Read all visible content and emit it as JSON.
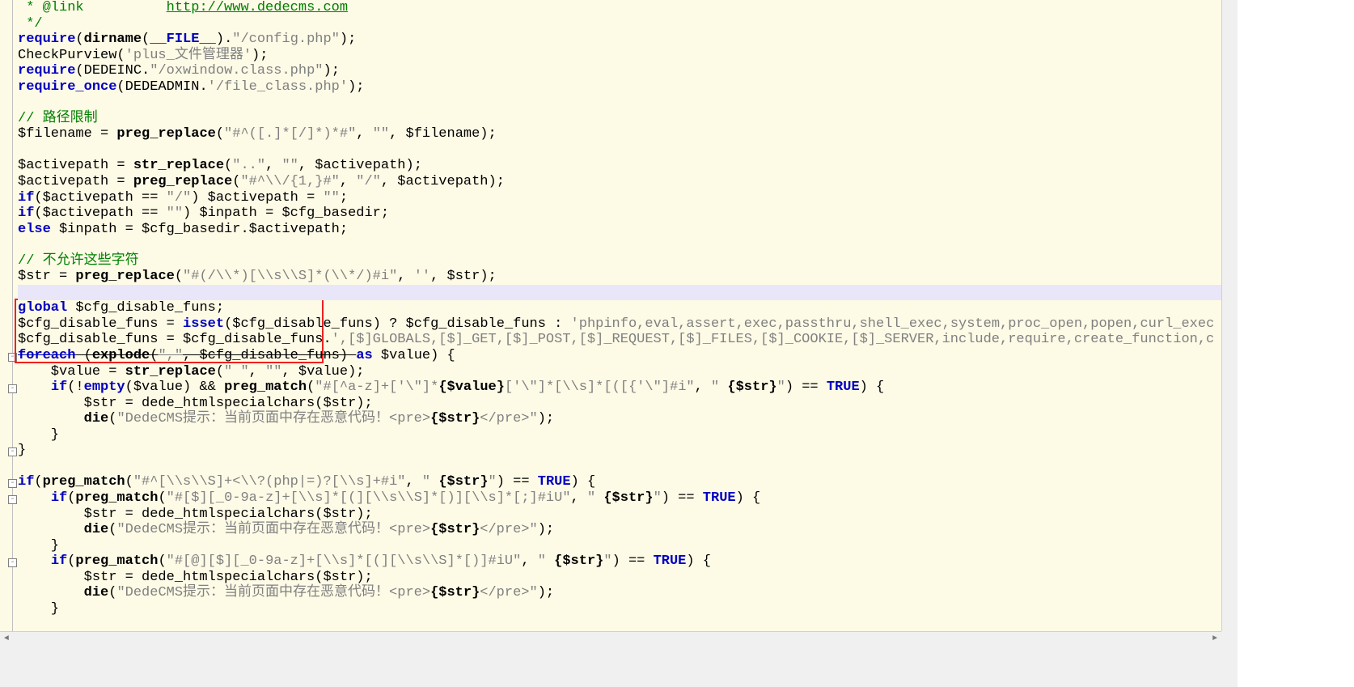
{
  "code": {
    "l0_pre": " * @link          ",
    "l0_link": "http://www.dedecms.com",
    "l1": " */",
    "l2_req": "require",
    "l2_rest": "(",
    "l2_dir": "dirname",
    "l2_file": "__FILE__",
    "l2_tail": ").",
    "l2_str": "\"/config.php\"",
    "l2_end": ");",
    "l3_a": "CheckPurview(",
    "l3_str": "'plus_文件管理器'",
    "l3_end": ");",
    "l4_req": "require",
    "l4_a": "(DEDEINC.",
    "l4_str": "\"/oxwindow.class.php\"",
    "l4_end": ");",
    "l5_req": "require_once",
    "l5_a": "(DEDEADMIN.",
    "l5_str": "'/file_class.php'",
    "l5_end": ");",
    "l7_cmt": "// 路径限制",
    "l8_a": "$filename = ",
    "l8_fn": "preg_replace",
    "l8_b": "(",
    "l8_s1": "\"#^([.]*[/]*)*#\"",
    "l8_c": ", ",
    "l8_s2": "\"\"",
    "l8_d": ", $filename);",
    "l10_a": "$activepath = ",
    "l10_fn": "str_replace",
    "l10_b": "(",
    "l10_s1": "\"..\"",
    "l10_c": ", ",
    "l10_s2": "\"\"",
    "l10_d": ", $activepath);",
    "l11_a": "$activepath = ",
    "l11_fn": "preg_replace",
    "l11_b": "(",
    "l11_s1": "\"#^\\\\/{1,}#\"",
    "l11_c": ", ",
    "l11_s2": "\"/\"",
    "l11_d": ", $activepath);",
    "l12_if": "if",
    "l12_a": "($activepath == ",
    "l12_s": "\"/\"",
    "l12_b": ") $activepath = ",
    "l12_s2": "\"\"",
    "l12_c": ";",
    "l13_if": "if",
    "l13_a": "($activepath == ",
    "l13_s": "\"\"",
    "l13_b": ") $inpath = $cfg_basedir;",
    "l14_else": "else",
    "l14_a": " $inpath = $cfg_basedir.$activepath;",
    "l16_cmt": "// 不允许这些字符",
    "l17_a": "$str = ",
    "l17_fn": "preg_replace",
    "l17_b": "(",
    "l17_s1": "\"#(/\\\\*)[\\\\s\\\\S]*(\\\\*/)#i\"",
    "l17_c": ", ",
    "l17_s2": "''",
    "l17_d": ", $str);",
    "l19_kw": "global",
    "l19_a": " $cfg_disable_funs;",
    "l20_a": "$cfg_disable_funs = ",
    "l20_kw": "isset",
    "l20_b": "($cfg_disable_funs) ? $cfg_disable_funs : ",
    "l20_s": "'phpinfo,eval,assert,exec,passthru,shell_exec,system,proc_open,popen,curl_exec",
    "l21_a": "$cfg_disable_funs = $cfg_disable_funs.",
    "l21_s": "',[$]GLOBALS,[$]_GET,[$]_POST,[$]_REQUEST,[$]_FILES,[$]_COOKIE,[$]_SERVER,include,require,create_function,c",
    "l22_kw": "foreach",
    "l22_a": " (",
    "l22_fn": "explode",
    "l22_b": "(",
    "l22_s": "\",\"",
    "l22_c": ", $cfg_disable_funs) ",
    "l22_as": "as",
    "l22_d": " $value) {",
    "l23_a": "    $value = ",
    "l23_fn": "str_replace",
    "l23_b": "(",
    "l23_s1": "\" \"",
    "l23_c": ", ",
    "l23_s2": "\"\"",
    "l23_d": ", $value);",
    "l24_if": "if",
    "l24_a": "(!",
    "l24_fn1": "empty",
    "l24_b": "($value) && ",
    "l24_fn2": "preg_match",
    "l24_c": "(",
    "l24_s1": "\"#[^a-z]+['\\\"]*",
    "l24_v1": "{$value}",
    "l24_s2": "['\\\"]*[\\\\s]*[([{'\\\"]#i\"",
    "l24_d": ", ",
    "l24_s3": "\" ",
    "l24_v2": "{$str}",
    "l24_s4": "\"",
    "l24_e": ") == ",
    "l24_true": "TRUE",
    "l24_f": ") {",
    "l25_a": "        $str = dede_htmlspecialchars($str);",
    "l26_fn": "die",
    "l26_a": "(",
    "l26_s1": "\"DedeCMS提示：当前页面中存在恶意代码！<pre>",
    "l26_v": "{$str}",
    "l26_s2": "</pre>\"",
    "l26_b": ");",
    "l27": "    }",
    "l28": "}",
    "l30_if": "if",
    "l30_a": "(",
    "l30_fn": "preg_match",
    "l30_b": "(",
    "l30_s1": "\"#^[\\\\s\\\\S]+<\\\\?(php|=)?[\\\\s]+#i\"",
    "l30_c": ", ",
    "l30_s2": "\" ",
    "l30_v": "{$str}",
    "l30_s3": "\"",
    "l30_d": ") == ",
    "l30_true": "TRUE",
    "l30_e": ") {",
    "l31_if": "if",
    "l31_a": "(",
    "l31_fn": "preg_match",
    "l31_b": "(",
    "l31_s1": "\"#[$][_0-9a-z]+[\\\\s]*[(][\\\\s\\\\S]*[)][\\\\s]*[;]#iU\"",
    "l31_c": ", ",
    "l31_s2": "\" ",
    "l31_v": "{$str}",
    "l31_s3": "\"",
    "l31_d": ") == ",
    "l31_true": "TRUE",
    "l31_e": ") {",
    "l32_a": "        $str = dede_htmlspecialchars($str);",
    "l33_fn": "die",
    "l33_a": "(",
    "l33_s1": "\"DedeCMS提示：当前页面中存在恶意代码！<pre>",
    "l33_v": "{$str}",
    "l33_s2": "</pre>\"",
    "l33_b": ");",
    "l34": "    }",
    "l35_if": "if",
    "l35_a": "(",
    "l35_fn": "preg_match",
    "l35_b": "(",
    "l35_s1": "\"#[@][$][_0-9a-z]+[\\\\s]*[(][\\\\s\\\\S]*[)]#iU\"",
    "l35_c": ", ",
    "l35_s2": "\" ",
    "l35_v": "{$str}",
    "l35_s3": "\"",
    "l35_d": ") == ",
    "l35_true": "TRUE",
    "l35_e": ") {",
    "l36_a": "        $str = dede_htmlspecialchars($str);",
    "l37_fn": "die",
    "l37_a": "(",
    "l37_s1": "\"DedeCMS提示：当前页面中存在恶意代码！<pre>",
    "l37_v": "{$str}",
    "l37_s2": "</pre>\"",
    "l37_b": ");",
    "l38": "    }"
  },
  "highlight_box": {
    "top_line": 19,
    "height_lines": 4
  }
}
